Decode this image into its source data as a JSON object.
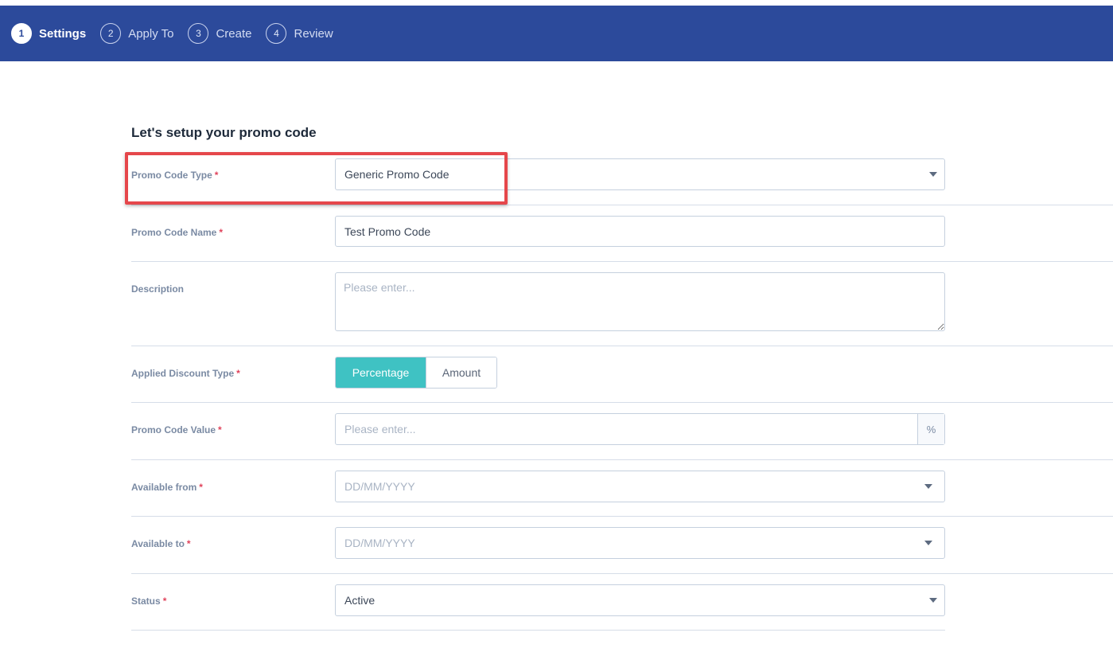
{
  "steps": [
    {
      "number": "1",
      "label": "Settings",
      "active": true
    },
    {
      "number": "2",
      "label": "Apply To",
      "active": false
    },
    {
      "number": "3",
      "label": "Create",
      "active": false
    },
    {
      "number": "4",
      "label": "Review",
      "active": false
    }
  ],
  "form": {
    "heading": "Let's setup your promo code",
    "required_mark": "*",
    "promo_code_type": {
      "label": "Promo Code Type",
      "value": "Generic Promo Code"
    },
    "promo_code_name": {
      "label": "Promo Code Name",
      "value": "Test Promo Code"
    },
    "description": {
      "label": "Description",
      "placeholder": "Please enter..."
    },
    "applied_discount_type": {
      "label": "Applied Discount Type",
      "options": [
        "Percentage",
        "Amount"
      ],
      "selected": "Percentage"
    },
    "promo_code_value": {
      "label": "Promo Code Value",
      "placeholder": "Please enter...",
      "suffix": "%"
    },
    "available_from": {
      "label": "Available from",
      "placeholder": "DD/MM/YYYY"
    },
    "available_to": {
      "label": "Available to",
      "placeholder": "DD/MM/YYYY"
    },
    "status": {
      "label": "Status",
      "value": "Active"
    }
  },
  "colors": {
    "header": "#2c4a9b",
    "accent": "#3fc2c3",
    "required": "#e0435b",
    "highlight": "#e5474b"
  }
}
